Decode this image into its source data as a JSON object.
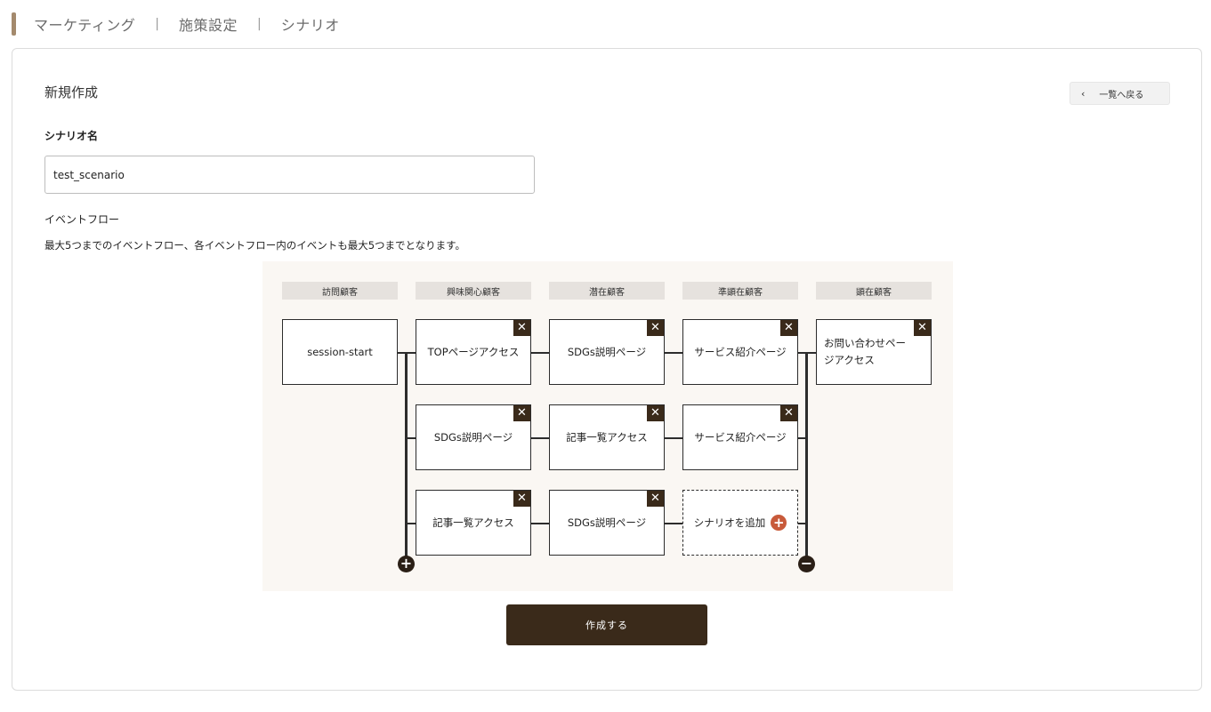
{
  "breadcrumb": [
    "マーケティング",
    "施策設定",
    "シナリオ"
  ],
  "page": {
    "title": "新規作成",
    "back_label": "一覧へ戻る",
    "back_icon": "chevron-left-icon",
    "field_label": "シナリオ名",
    "scenario_name": "test_scenario",
    "section_label": "イベントフロー",
    "section_note": "最大5つまでのイベントフロー、各イベントフロー内のイベントも最大5つまでとなります。",
    "create_label": "作成する"
  },
  "flow": {
    "columns": [
      "訪問顧客",
      "興味関心顧客",
      "潜在顧客",
      "準顕在顧客",
      "顕在顧客"
    ],
    "start_node": "session-start",
    "rows": [
      [
        "TOPページアクセス",
        "SDGs説明ページ",
        "サービス紹介ページ"
      ],
      [
        "SDGs説明ページ",
        "記事一覧アクセス",
        "サービス紹介ページ"
      ],
      [
        "記事一覧アクセス",
        "SDGs説明ページ"
      ]
    ],
    "final_node": "お問い合わせページアクセス",
    "add_label": "シナリオを追加",
    "delete_glyph": "✕",
    "add_glyph": "+",
    "remove_glyph": "−",
    "add_color": "#c85a3a",
    "accent_color": "#3a2a1a"
  }
}
